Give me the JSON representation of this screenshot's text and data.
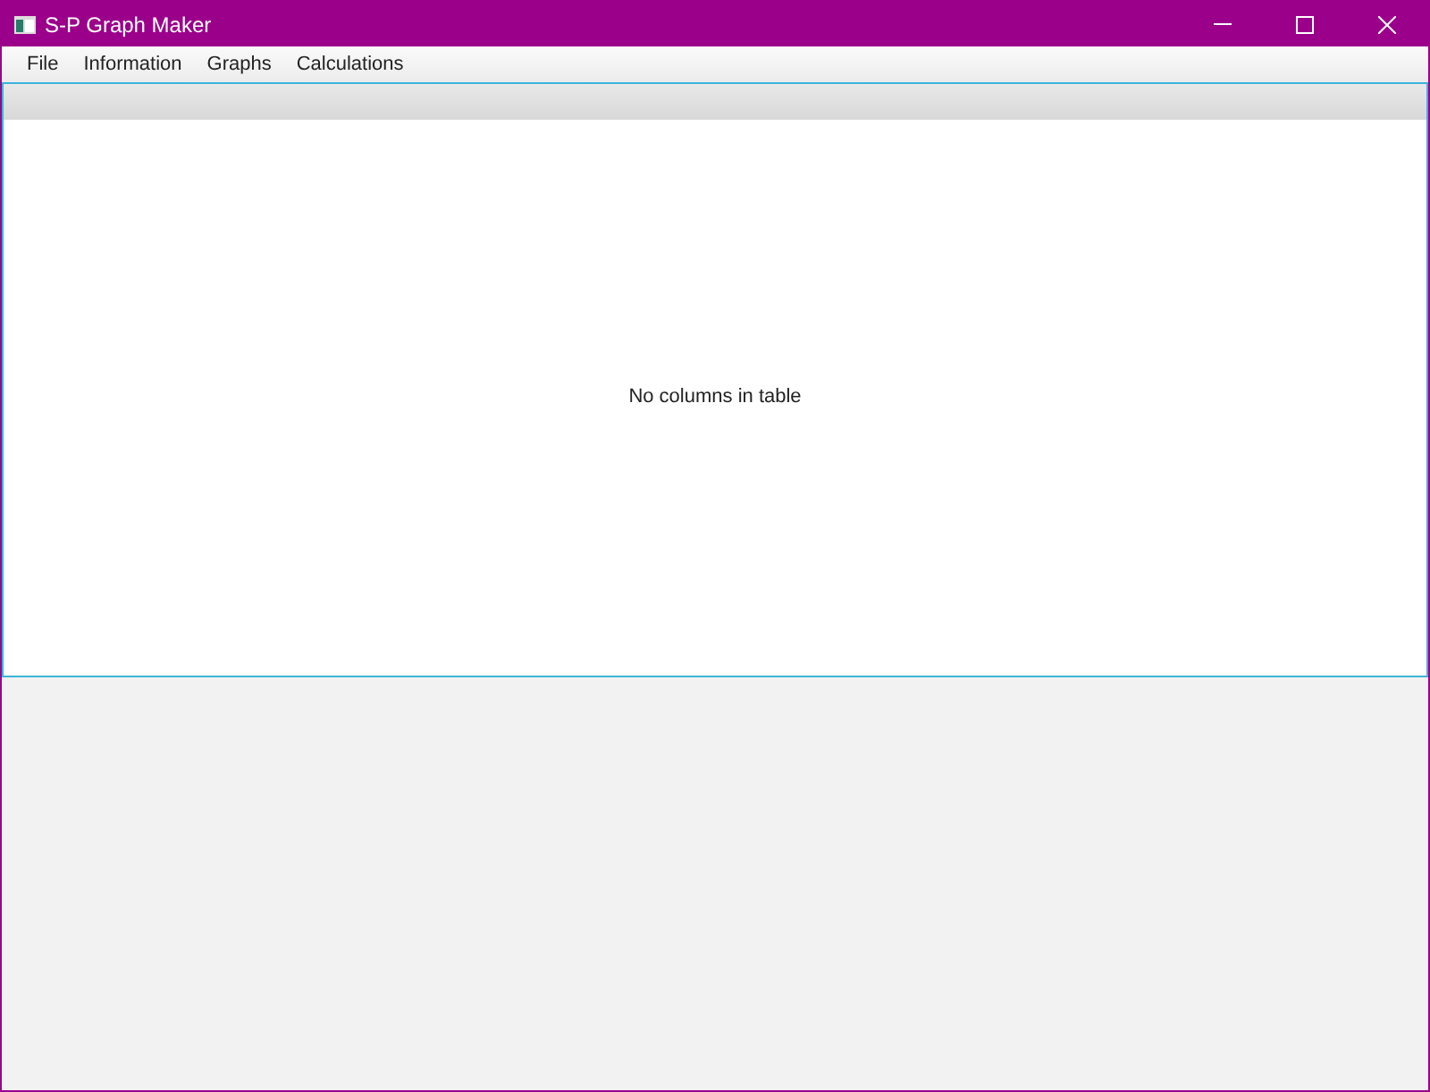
{
  "window": {
    "title": "S-P Graph Maker"
  },
  "menu": [
    {
      "label": "File"
    },
    {
      "label": "Information"
    },
    {
      "label": "Graphs"
    },
    {
      "label": "Calculations"
    }
  ],
  "table": {
    "empty_message": "No columns in table"
  }
}
